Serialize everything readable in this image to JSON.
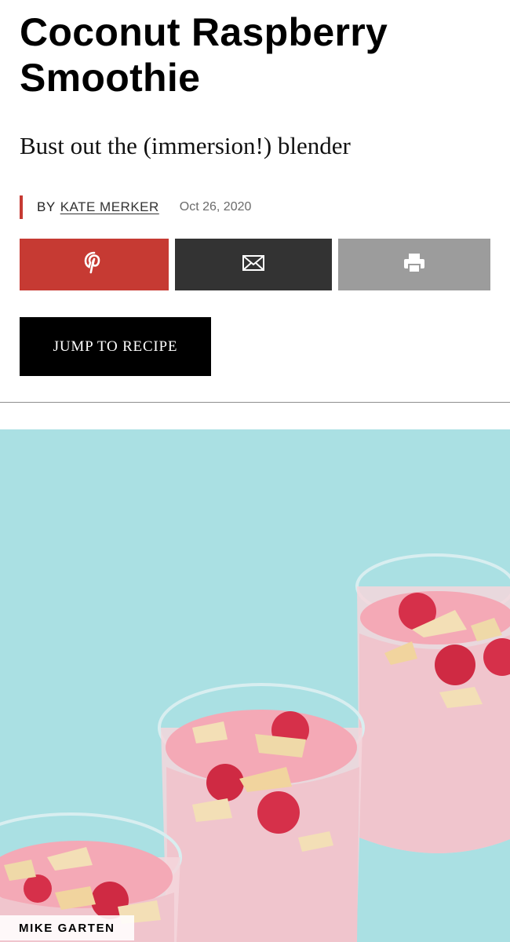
{
  "article": {
    "title": "Coconut Raspberry Smoothie",
    "dek": "Bust out the (immersion!) blender",
    "byline": {
      "prefix": "BY",
      "author": "KATE MERKER",
      "date": "Oct 26, 2020"
    }
  },
  "share": {
    "buttons": [
      {
        "name": "pinterest",
        "icon": "pinterest-icon",
        "color": "#c63a33"
      },
      {
        "name": "email",
        "icon": "envelope-icon",
        "color": "#333333"
      },
      {
        "name": "print",
        "icon": "printer-icon",
        "color": "#9c9c9c"
      }
    ]
  },
  "jump_button": {
    "label": "JUMP TO RECIPE"
  },
  "hero": {
    "subject": "smoothie-glasses-photo",
    "background_color": "#aee3e6",
    "credit": "MIKE GARTEN"
  },
  "colors": {
    "accent": "#c63a33",
    "text": "#000000"
  }
}
